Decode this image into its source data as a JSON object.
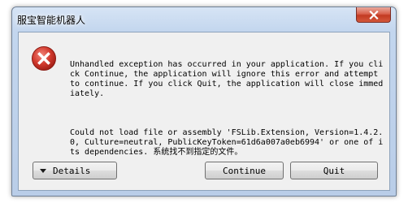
{
  "window": {
    "title": "服宝智能机器人"
  },
  "icons": {
    "close": "close-icon",
    "error": "error-icon",
    "details_caret": "chevron-down-icon"
  },
  "colors": {
    "error_red": "#c8322a",
    "close_red": "#c23a22",
    "frame_blue": "#c3d6ee",
    "client_bg": "#f0f0f0"
  },
  "message": {
    "paragraph1": "Unhandled exception has occurred in your application. If you click Continue, the application will ignore this error and attempt to continue. If you click Quit, the application will close immediately.",
    "paragraph2": "Could not load file or assembly 'FSLib.Extension, Version=1.4.2.0, Culture=neutral, PublicKeyToken=61d6a007a0eb6994' or one of its dependencies. 系统找不到指定的文件。"
  },
  "buttons": {
    "details": "Details",
    "continue": "Continue",
    "quit": "Quit"
  }
}
